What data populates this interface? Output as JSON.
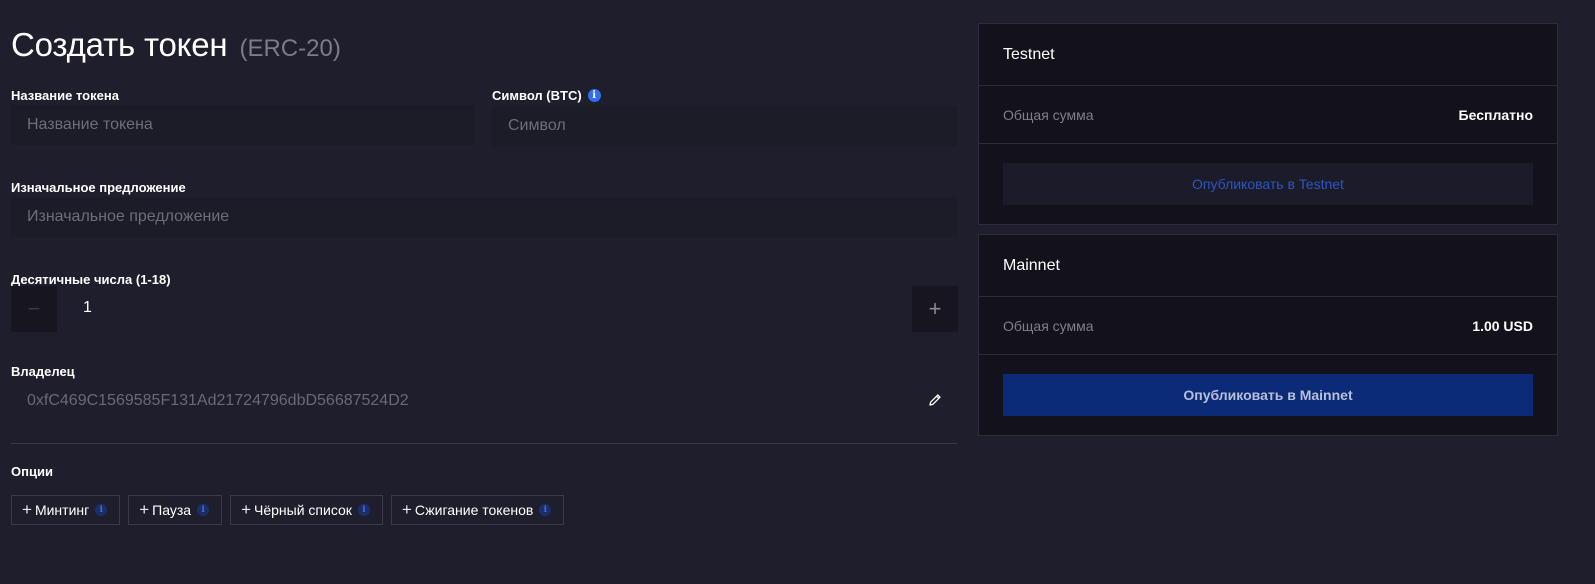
{
  "page": {
    "title": "Создать токен",
    "subtitle": "(ERC-20)"
  },
  "form": {
    "token_name": {
      "label": "Название токена",
      "placeholder": "Название токена",
      "value": ""
    },
    "symbol": {
      "label": "Символ (BTC)",
      "placeholder": "Символ",
      "value": "",
      "info_icon": "info-icon"
    },
    "initial_supply": {
      "label": "Изначальное предложение",
      "placeholder": "Изначальное предложение",
      "value": ""
    },
    "decimals": {
      "label": "Десятичные числа (1-18)",
      "value": "1",
      "minus": "−",
      "plus": "+"
    },
    "owner": {
      "label": "Владелец",
      "value": "0xfC469C1569585F131Ad21724796dbD56687524D2",
      "edit_icon": "pencil-icon"
    }
  },
  "options": {
    "label": "Опции",
    "items": [
      {
        "label": "Минтинг"
      },
      {
        "label": "Пауза"
      },
      {
        "label": "Чёрный список"
      },
      {
        "label": "Сжигание токенов"
      }
    ]
  },
  "testnet_card": {
    "title": "Testnet",
    "total_label": "Общая сумма",
    "total_value": "Бесплатно",
    "button": "Опубликовать в Testnet"
  },
  "mainnet_card": {
    "title": "Mainnet",
    "total_label": "Общая сумма",
    "total_value": "1.00 USD",
    "button": "Опубликовать в Mainnet"
  },
  "colors": {
    "background": "#1f1e2c",
    "card": "#13121c",
    "accent": "#2f6ff0",
    "mainnet_button": "#0b2a78"
  }
}
